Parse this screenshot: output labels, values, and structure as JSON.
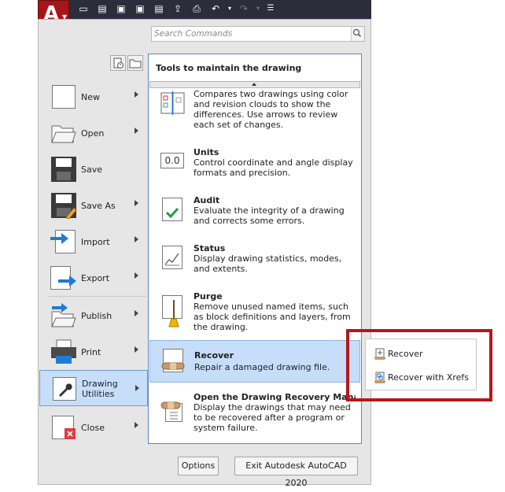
{
  "app": {
    "logo_letter": "A"
  },
  "search": {
    "placeholder": "Search Commands"
  },
  "left_menu": [
    {
      "key": "new",
      "label": "New"
    },
    {
      "key": "open",
      "label": "Open"
    },
    {
      "key": "save",
      "label": "Save"
    },
    {
      "key": "saveas",
      "label": "Save As"
    },
    {
      "key": "import",
      "label": "Import"
    },
    {
      "key": "export",
      "label": "Export"
    },
    {
      "key": "publish",
      "label": "Publish"
    },
    {
      "key": "print",
      "label": "Print"
    },
    {
      "key": "drawing_utilities",
      "label": "Drawing Utilities"
    },
    {
      "key": "close",
      "label": "Close"
    }
  ],
  "panel": {
    "title": "Tools to maintain the drawing",
    "items": [
      {
        "title": "",
        "desc": "Compares two drawings using color and revision clouds to show the differences. Use arrows to review each set of changes."
      },
      {
        "title": "Units",
        "desc": "Control coordinate and angle display formats and precision."
      },
      {
        "title": "Audit",
        "desc": "Evaluate the integrity of a drawing and corrects some errors."
      },
      {
        "title": "Status",
        "desc": "Display drawing statistics, modes, and extents."
      },
      {
        "title": "Purge",
        "desc": "Remove unused named items, such as block definitions and layers, from the drawing."
      },
      {
        "title": "Recover",
        "desc": "Repair a damaged drawing file."
      },
      {
        "title": "Open the Drawing Recovery Manager",
        "desc": "Display the drawings that may need to be recovered after a program or system failure."
      }
    ],
    "units_icon_text": "0.0"
  },
  "buttons": {
    "options": "Options",
    "exit": "Exit Autodesk AutoCAD 2020"
  },
  "flyout": {
    "items": [
      "Recover",
      "Recover with Xrefs"
    ]
  },
  "colors": {
    "active_bg": "#c7defa",
    "highlight_box": "#b5161c",
    "logo_red": "#a6151b"
  }
}
